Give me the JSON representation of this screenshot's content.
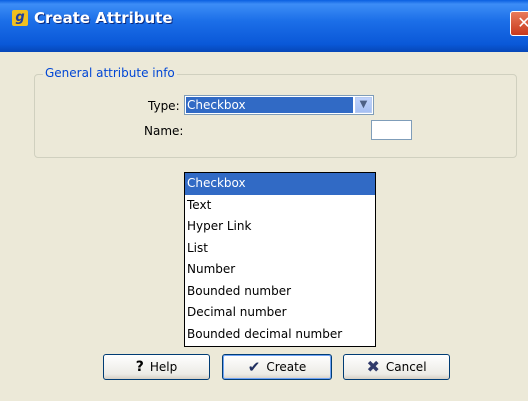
{
  "window": {
    "title": "Create Attribute",
    "app_icon_glyph": "g",
    "close_glyph": "✕"
  },
  "group": {
    "legend": "General attribute info"
  },
  "form": {
    "type_label": "Type:",
    "type_value": "Checkbox",
    "name_label": "Name:",
    "name_value": ""
  },
  "dropdown": {
    "options": [
      "Checkbox",
      "Text",
      "Hyper Link",
      "List",
      "Number",
      "Bounded number",
      "Decimal number",
      "Bounded decimal number"
    ],
    "selected": "Checkbox"
  },
  "buttons": {
    "help": "Help",
    "create": "Create",
    "cancel": "Cancel"
  },
  "icons": {
    "help": "question-icon",
    "create": "checkmark-icon",
    "cancel": "x-icon",
    "dropdown": "chevron-down-icon"
  },
  "colors": {
    "titlebar": "#0a5fe0",
    "selection": "#316ac5",
    "legend": "#0046d5",
    "dialog_bg": "#ece9d8"
  }
}
